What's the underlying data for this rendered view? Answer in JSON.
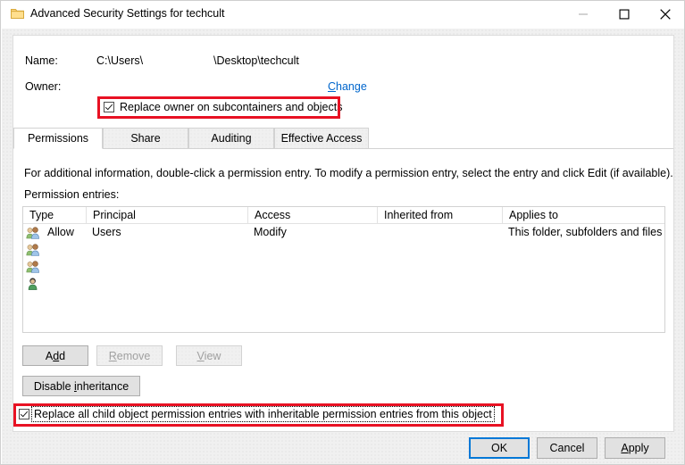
{
  "window": {
    "title": "Advanced Security Settings for techcult",
    "folder_icon": "folder-icon",
    "minimize_label": "Minimize",
    "maximize_label": "Maximize",
    "close_label": "Close"
  },
  "header": {
    "name_label": "Name:",
    "name_value_prefix": "C:\\Users\\",
    "name_value_suffix": "\\Desktop\\techcult",
    "owner_label": "Owner:",
    "owner_value": "",
    "change_link_accel": "C",
    "change_link_rest": "hange"
  },
  "replace_owner": {
    "label": "Replace owner on subcontainers and objects",
    "checked": true,
    "highlighted": true
  },
  "tabs": [
    {
      "label": "Permissions",
      "active": true
    },
    {
      "label": "Share",
      "active": false
    },
    {
      "label": "Auditing",
      "active": false
    },
    {
      "label": "Effective Access",
      "active": false
    }
  ],
  "main": {
    "instruction": "For additional information, double-click a permission entry. To modify a permission entry, select the entry and click Edit (if available).",
    "entries_label": "Permission entries:"
  },
  "table": {
    "columns": [
      "Type",
      "Principal",
      "Access",
      "Inherited from",
      "Applies to"
    ],
    "rows": [
      {
        "icon": "users-group-icon",
        "type": "Allow",
        "principal": "Users",
        "access": "Modify",
        "inherited_from": "",
        "applies_to": "This folder, subfolders and files"
      },
      {
        "icon": "users-group-icon",
        "type": "",
        "principal": "",
        "access": "",
        "inherited_from": "",
        "applies_to": ""
      },
      {
        "icon": "users-group-icon",
        "type": "",
        "principal": "",
        "access": "",
        "inherited_from": "",
        "applies_to": ""
      },
      {
        "icon": "single-user-icon",
        "type": "",
        "principal": "",
        "access": "",
        "inherited_from": "",
        "applies_to": ""
      }
    ]
  },
  "buttons": {
    "add": {
      "pre": "A",
      "accel": "d",
      "post": "d",
      "enabled": true
    },
    "remove": {
      "pre": "",
      "accel": "R",
      "post": "emove",
      "enabled": false
    },
    "view": {
      "pre": "",
      "accel": "V",
      "post": "iew",
      "enabled": false
    },
    "disable_inheritance": {
      "pre": "Disable ",
      "accel": "i",
      "post": "nheritance",
      "enabled": true
    },
    "ok": {
      "label": "OK",
      "default": true
    },
    "cancel": {
      "label": "Cancel",
      "default": false
    },
    "apply": {
      "pre": "",
      "accel": "A",
      "post": "pply",
      "default": false
    }
  },
  "replace_child": {
    "label": "Replace all child object permission entries with inheritable permission entries from this object",
    "checked": true,
    "focused": true,
    "highlighted": true
  },
  "colors": {
    "highlight_red": "#e81123",
    "link_blue": "#0066cc",
    "default_button_blue": "#0078d7"
  }
}
